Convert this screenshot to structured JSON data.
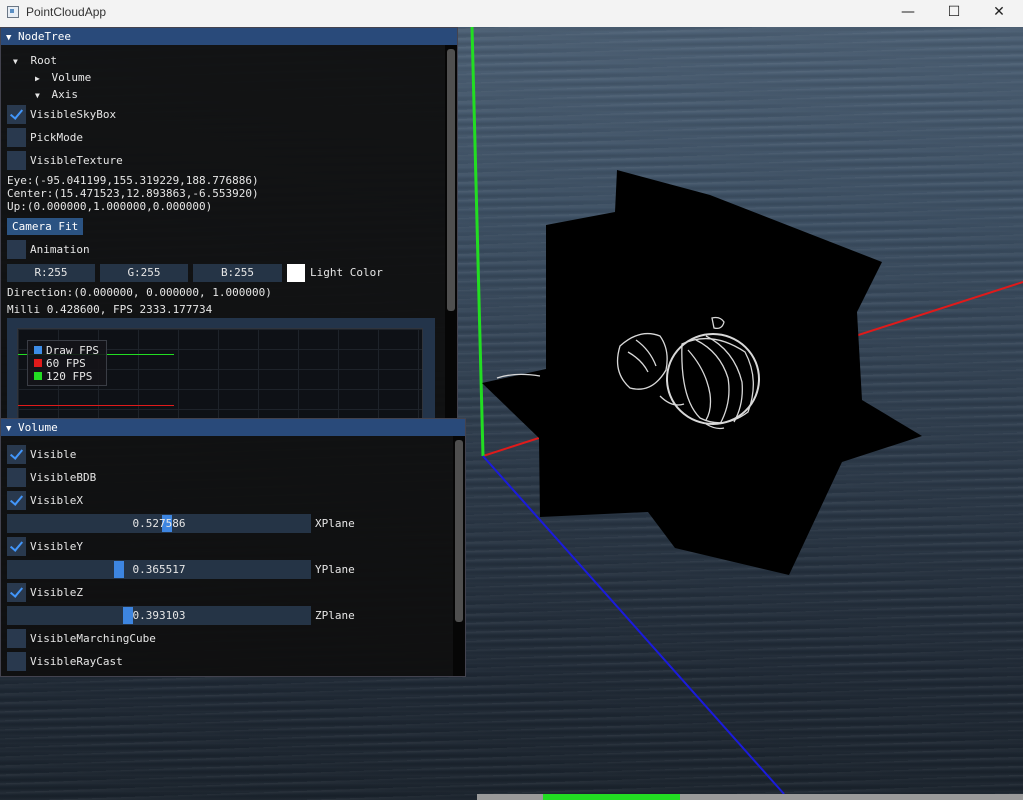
{
  "app": {
    "title": "PointCloudApp"
  },
  "window_controls": {
    "minimize": "—",
    "maximize": "☐",
    "close": "✕"
  },
  "colors": {
    "accent": "#4296fa",
    "axis_x": "#e01a1a",
    "axis_y": "#22dd22",
    "axis_z": "#1b1bdd"
  },
  "node_tree": {
    "title": "NodeTree",
    "root_label": "Root",
    "children": [
      {
        "label": "Volume",
        "expanded": false
      },
      {
        "label": "Axis",
        "expanded": true
      }
    ],
    "checkboxes": [
      {
        "label": "VisibleSkyBox",
        "checked": true
      },
      {
        "label": "PickMode",
        "checked": false
      },
      {
        "label": "VisibleTexture",
        "checked": false
      }
    ],
    "eye": "Eye:(-95.041199,155.319229,188.776886)",
    "center": "Center:(15.471523,12.893863,-6.553920)",
    "up": "Up:(0.000000,1.000000,0.000000)",
    "camera_fit": "Camera Fit",
    "animation": {
      "label": "Animation",
      "checked": false
    },
    "light": {
      "r": "R:255",
      "g": "G:255",
      "b": "B:255",
      "label": "Light Color",
      "swatch": "#ffffff"
    },
    "direction": "Direction:(0.000000, 0.000000, 1.000000)",
    "stats": "Milli 0.428600, FPS 2333.177734",
    "plot_legend": [
      {
        "label": "Draw FPS",
        "color": "#3d8ce6"
      },
      {
        "label": "60 FPS",
        "color": "#e01a1a"
      },
      {
        "label": "120 FPS",
        "color": "#22dd22"
      }
    ]
  },
  "volume": {
    "title": "Volume",
    "checkboxes": [
      {
        "label": "Visible",
        "checked": true
      },
      {
        "label": "VisibleBDB",
        "checked": false
      },
      {
        "label": "VisibleX",
        "checked": true
      },
      {
        "label": "VisibleY",
        "checked": true
      },
      {
        "label": "VisibleZ",
        "checked": true
      },
      {
        "label": "VisibleMarchingCube",
        "checked": false
      },
      {
        "label": "VisibleRayCast",
        "checked": false
      }
    ],
    "sliders": [
      {
        "label": "XPlane",
        "value_text": "0.527586",
        "value": 0.527586
      },
      {
        "label": "YPlane",
        "value_text": "0.365517",
        "value": 0.365517
      },
      {
        "label": "ZPlane",
        "value_text": "0.393103",
        "value": 0.393103
      }
    ]
  }
}
